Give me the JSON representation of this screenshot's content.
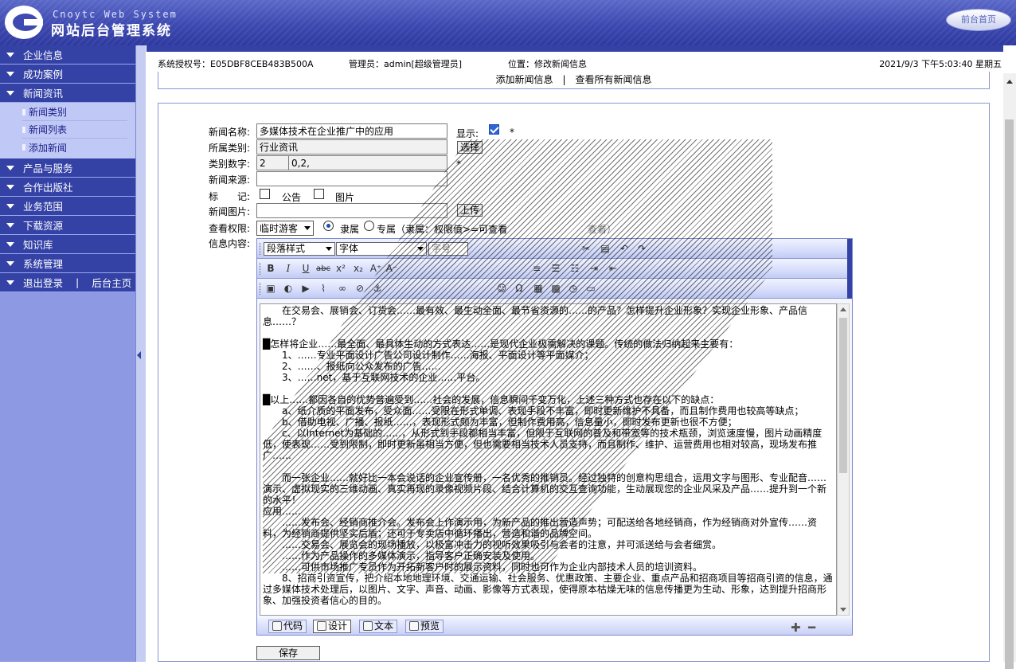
{
  "header": {
    "brand_en": "Cnoytc Web System",
    "brand_cn": "网站后台管理系统",
    "front_home": "前台首页"
  },
  "sidebar": {
    "sections": [
      {
        "label": "企业信息"
      },
      {
        "label": "成功案例"
      },
      {
        "label": "新闻资讯",
        "items": [
          "新闻类别",
          "新闻列表",
          "添加新闻"
        ]
      },
      {
        "label": "产品与服务"
      },
      {
        "label": "合作出版社"
      },
      {
        "label": "业务范围"
      },
      {
        "label": "下载资源"
      },
      {
        "label": "知识库"
      },
      {
        "label": "系统管理"
      }
    ],
    "logout": "退出登录",
    "backend_home": "后台主页"
  },
  "infobar": {
    "license": "系统授权号：E05DBF8CEB483B500A",
    "admin": "管理员：admin[超级管理员]",
    "location": "位置：修改新闻信息",
    "datetime": "2021/9/3 下午5:03:40 星期五"
  },
  "actions": {
    "add": "添加新闻信息",
    "separator": "|",
    "view_all": "查看所有新闻信息"
  },
  "form": {
    "name_label": "新闻名称:",
    "name_value": "多媒体技术在企业推广中的应用",
    "show_label": "显示:",
    "required": "*",
    "category_label": "所属类别:",
    "category_value": "行业资讯",
    "choose_btn": "选择",
    "catnum_label": "类别数字:",
    "catnum_value1": "2",
    "catnum_value2": "0,2,",
    "source_label": "新闻来源:",
    "source_value": "",
    "mark_label": "标　　记:",
    "mark_notice": "公告",
    "mark_picture": "图片",
    "image_label": "新闻图片:",
    "image_value": "",
    "upload_btn": "上传",
    "perm_label": "查看权限:",
    "perm_select": "临时游客",
    "perm_opt1": "隶属",
    "perm_opt2": "专属（隶属：权限值>=可查看",
    "perm_tail": "查看）",
    "content_label": "信息内容:",
    "save_btn": "保存"
  },
  "editor": {
    "para_style": "段落样式",
    "font": "字体",
    "font_size": "字号",
    "modes": [
      "代码",
      "设计",
      "文本",
      "预览"
    ],
    "content": [
      "　　在交易会、展销会、订货会……最有效、最生动全面、最节省资源的……的产品？怎样提升企业形象？实现企业形象、产品信息……？",
      "",
      "█怎样将企业……最全面、最具体生动的方式表达……是现代企业极需解决的课题。传统的做法归纳起来主要有：",
      "　　1、……专业平面设计广告公司设计制作……海报、平面设计等平面媒介；",
      "　　2、……、报纸向公众发布的广告……",
      "　　3、……net，基于互联网技术的企业……平台。",
      "",
      "█以上……都因各自的优势普遍受到……社会的发展，信息瞬间千变万化，上述三种方式也存在以下的缺点：",
      "　　a、纸介质的平面发布，受众面……受限在形式单调、表现手段不丰富，即时更新维护不具备，而且制作费用也较高等缺点；",
      "　　b、借助电视、广播、报纸……，表现形式颇为丰富，但制作费用高，信息量小，即时发布更新也很不方便；",
      "　　c、以Internet为基础的……，从形式到手段都相当丰富，但限于互联网的普及和带宽等的技术瓶颈，浏览速度慢，图片动画精度低，使表现……受到限制，即时更新虽相当方便，但也需要相当技术人员支持，而且制作、维护、运营费用也相对较高，现场发布推广……",
      "",
      "　　而一张企业……就好比一本会说话的企业宣传册，一名优秀的推销员。经过独特的创意构思组合，运用文字与图形、专业配音……演示、虚拟现实的三维动画、真实再现的录像视频片段、结合计算机的交互查询功能，生动展现您的企业风采及产品……提升到一个新的水平！",
      "应用……",
      "　　……发布会、经销商推介会。发布会上作演示用，为新产品的推出营造声势；可配送给各地经销商，作为经销商对外宣传……资料，为经销商提供坚实后盾；还可于专卖店中循环播出，营造和谐的品牌空间。",
      "　　……交易会、展览会的现场播放，以极富冲击力的视听效果吸引与会者的注意，并可派送给与会者细赏。",
      "　　……作为产品操作的多媒体演示，指导客户正确安装及使用。",
      "　　……可供市场推广专员作为开拓新客户时的展示资料，同时也可作为企业内部技术人员的培训资料。",
      "　　8、招商引资宣传，把介绍本地地理环境、交通运输、社会服务、优惠政策、主要企业、重点产品和招商项目等招商引资的信息，通过多媒体技术处理后，以图片、文字、声音、动画、影像等方式表现，使得原本枯燥无味的信息传播更为生动、形象，达到提升招商形象、加强投资者信心的目的。"
    ]
  },
  "colors": {
    "nav_dark": "#3442a6",
    "nav_light": "#8d9ae3",
    "sub_bg": "#c0c8f5",
    "checkbox_on": "#2d64d6"
  }
}
